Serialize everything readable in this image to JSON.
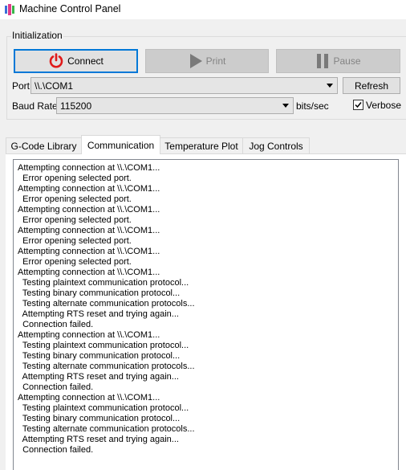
{
  "window": {
    "title": "Machine Control Panel",
    "icon": "app-icon"
  },
  "init_group": {
    "title": "Initialization",
    "connect_label": "Connect",
    "print_label": "Print",
    "pause_label": "Pause",
    "port_label": "Port",
    "port_value": "\\\\.\\COM1",
    "refresh_label": "Refresh",
    "baud_label": "Baud Rate",
    "baud_value": "115200",
    "baud_unit": "bits/sec",
    "verbose_label": "Verbose",
    "verbose_checked": true
  },
  "tabs": [
    {
      "label": "G-Code Library",
      "active": false
    },
    {
      "label": "Communication",
      "active": true
    },
    {
      "label": "Temperature Plot",
      "active": false
    },
    {
      "label": "Jog Controls",
      "active": false
    }
  ],
  "log_lines": [
    "Attempting connection at \\\\.\\COM1...",
    "  Error opening selected port.",
    "Attempting connection at \\\\.\\COM1...",
    "  Error opening selected port.",
    "Attempting connection at \\\\.\\COM1...",
    "  Error opening selected port.",
    "Attempting connection at \\\\.\\COM1...",
    "  Error opening selected port.",
    "Attempting connection at \\\\.\\COM1...",
    "  Error opening selected port.",
    "Attempting connection at \\\\.\\COM1...",
    "  Testing plaintext communication protocol...",
    "  Testing binary communication protocol...",
    "  Testing alternate communication protocols...",
    "  Attempting RTS reset and trying again...",
    "  Connection failed.",
    "Attempting connection at \\\\.\\COM1...",
    "  Testing plaintext communication protocol...",
    "  Testing binary communication protocol...",
    "  Testing alternate communication protocols...",
    "  Attempting RTS reset and trying again...",
    "  Connection failed.",
    "Attempting connection at \\\\.\\COM1...",
    "  Testing plaintext communication protocol...",
    "  Testing binary communication protocol...",
    "  Testing alternate communication protocols...",
    "  Attempting RTS reset and trying again...",
    "  Connection failed."
  ],
  "colors": {
    "power_icon": "#e01a1a",
    "accent": "#0078d7"
  }
}
